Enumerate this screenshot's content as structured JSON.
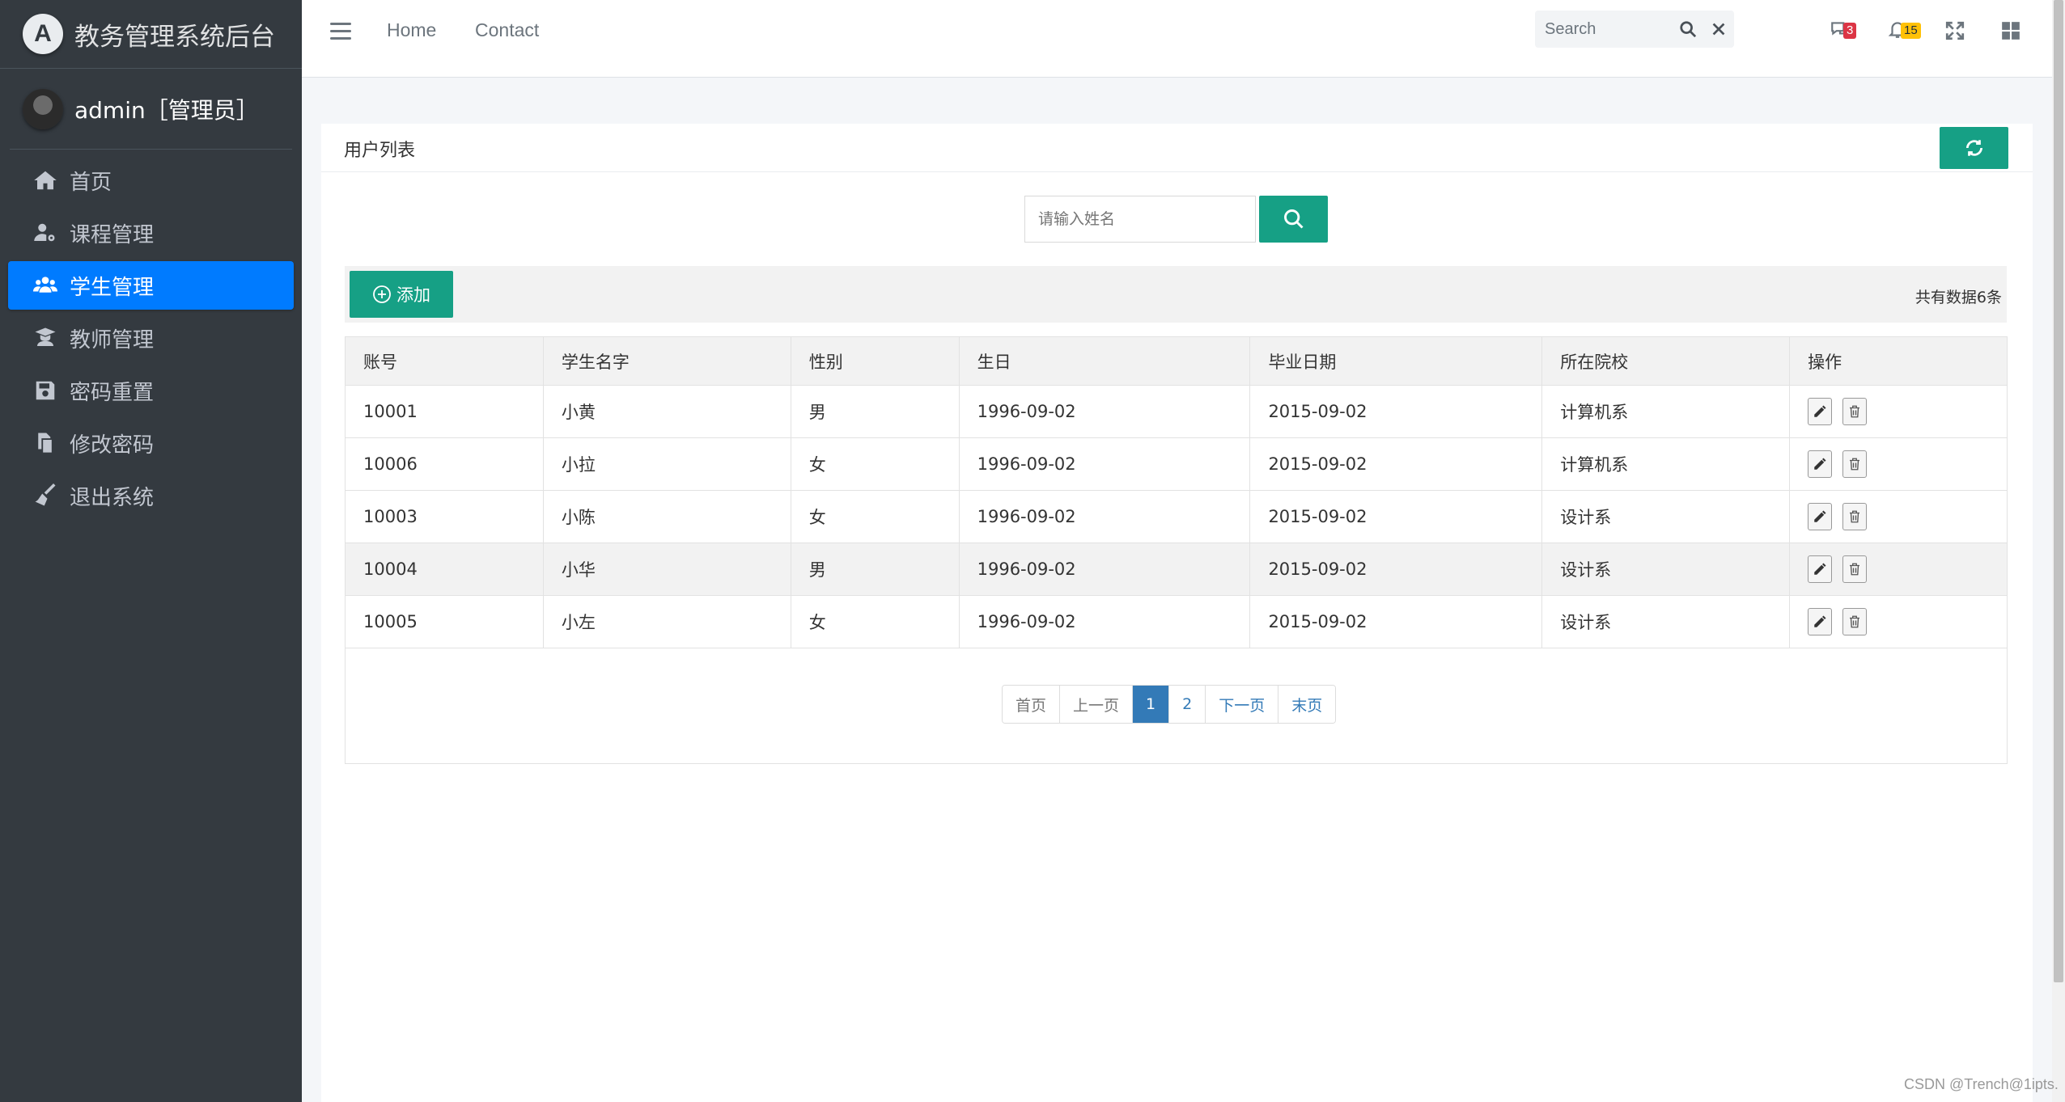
{
  "sidebar": {
    "brand_logo": "A",
    "brand_text": "教务管理系统后台",
    "user": "admin［管理员］",
    "items": [
      {
        "label": "首页",
        "icon": "home-icon"
      },
      {
        "label": "课程管理",
        "icon": "user-cog-icon"
      },
      {
        "label": "学生管理",
        "icon": "users-icon",
        "active": true
      },
      {
        "label": "教师管理",
        "icon": "graduation-cap-icon"
      },
      {
        "label": "密码重置",
        "icon": "save-icon"
      },
      {
        "label": "修改密码",
        "icon": "copy-icon"
      },
      {
        "label": "退出系统",
        "icon": "broom-icon"
      }
    ]
  },
  "topbar": {
    "home": "Home",
    "contact": "Contact",
    "search_placeholder": "Search",
    "messages_count": "3",
    "notifications_count": "15"
  },
  "card": {
    "title": "用户列表",
    "name_placeholder": "请输入姓名",
    "add_label": "添加",
    "total": "共有数据6条"
  },
  "table": {
    "columns": [
      "账号",
      "学生名字",
      "性别",
      "生日",
      "毕业日期",
      "所在院校",
      "操作"
    ],
    "rows": [
      [
        "10001",
        "小黄",
        "男",
        "1996-09-02",
        "2015-09-02",
        "计算机系"
      ],
      [
        "10006",
        "小拉",
        "女",
        "1996-09-02",
        "2015-09-02",
        "计算机系"
      ],
      [
        "10003",
        "小陈",
        "女",
        "1996-09-02",
        "2015-09-02",
        "设计系"
      ],
      [
        "10004",
        "小华",
        "男",
        "1996-09-02",
        "2015-09-02",
        "设计系"
      ],
      [
        "10005",
        "小左",
        "女",
        "1996-09-02",
        "2015-09-02",
        "设计系"
      ]
    ]
  },
  "pager": {
    "first": "首页",
    "prev": "上一页",
    "page1": "1",
    "page2": "2",
    "next": "下一页",
    "last": "末页"
  },
  "watermark": "CSDN @Trench@1ipts.",
  "colors": {
    "sidebar_bg": "#343a40",
    "active_nav": "#007bff",
    "accent": "#16a085",
    "pager_active": "#337ab7"
  }
}
